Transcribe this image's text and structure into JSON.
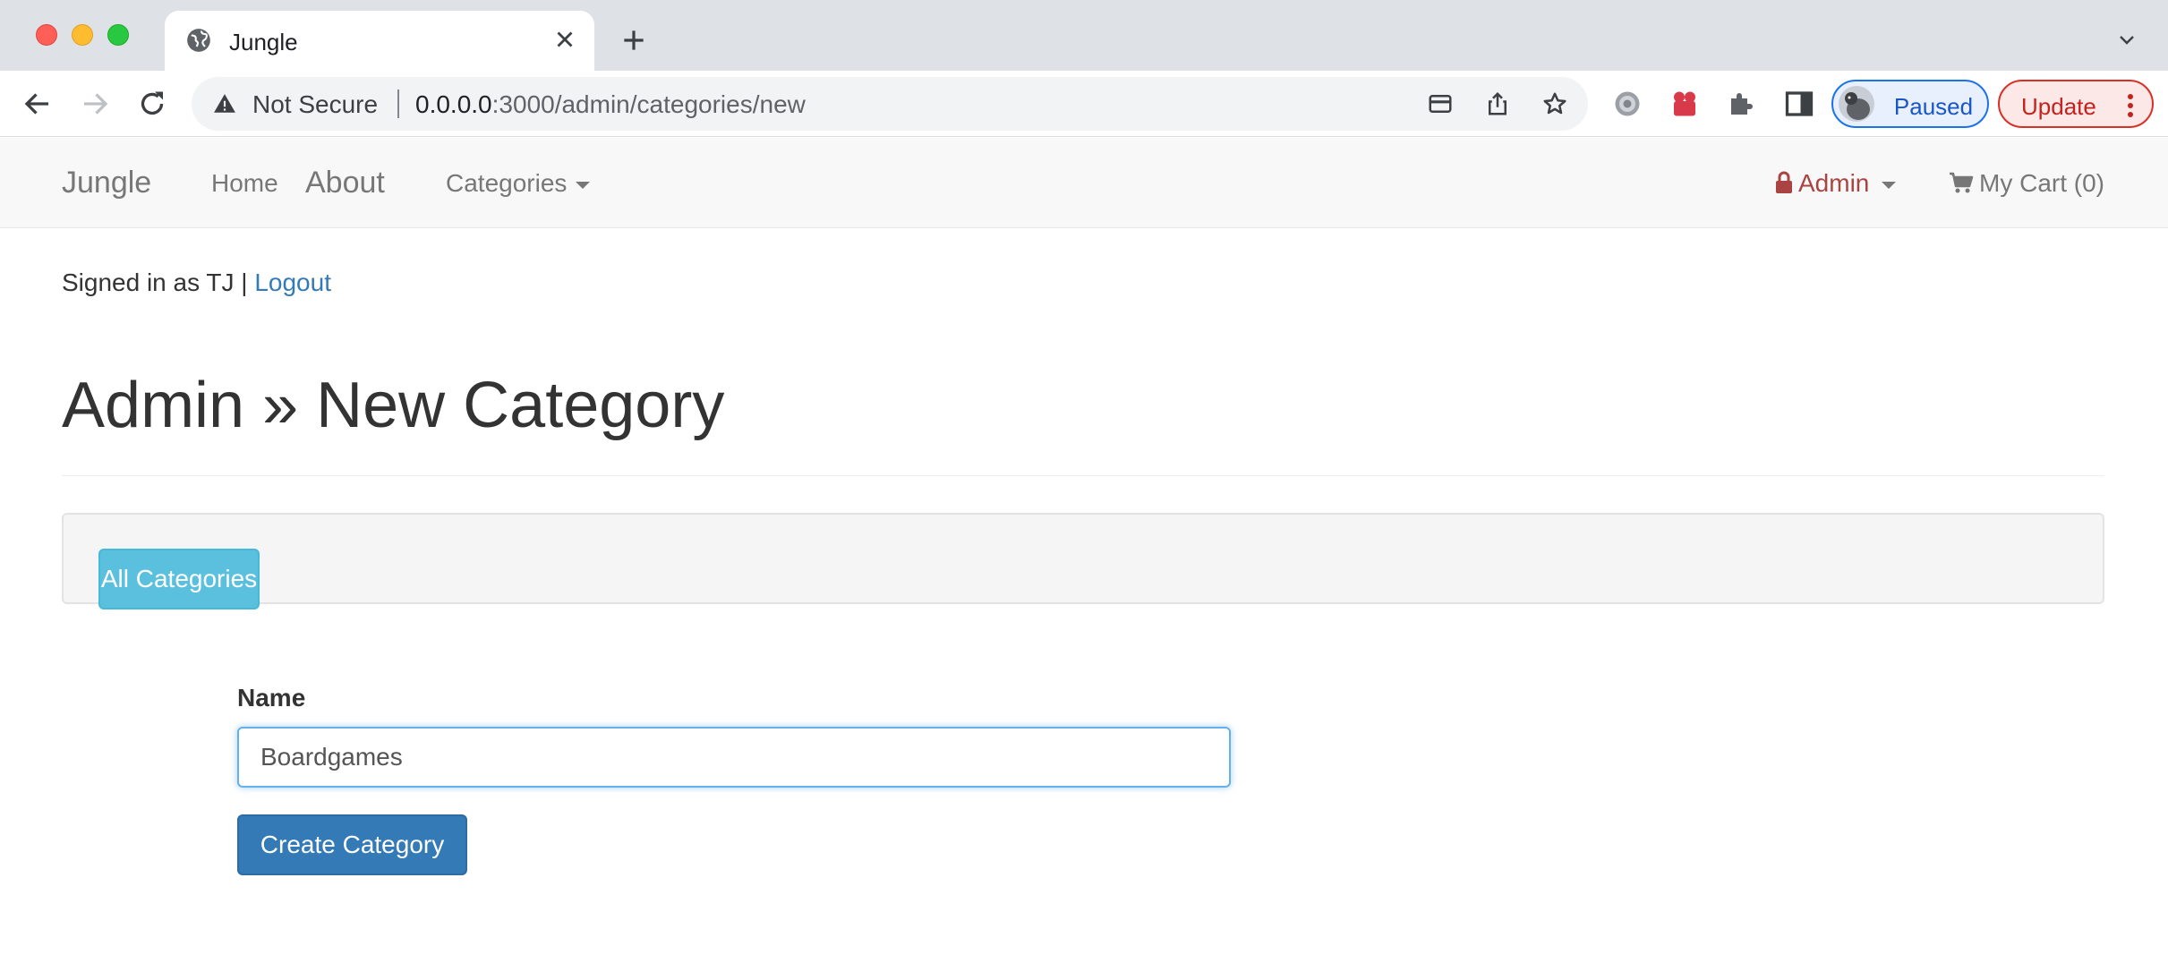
{
  "browser": {
    "tab": {
      "title": "Jungle"
    },
    "address_bar": {
      "security_label": "Not Secure",
      "url_host": "0.0.0.0",
      "url_path": ":3000/admin/categories/new"
    },
    "profile": {
      "label": "Paused"
    },
    "update": {
      "label": "Update"
    }
  },
  "navbar": {
    "brand": "Jungle",
    "home": "Home",
    "about": "About",
    "categories": "Categories",
    "admin": "Admin",
    "cart": "My Cart (0)"
  },
  "session": {
    "signed_in_text": "Signed in as TJ | ",
    "logout": "Logout"
  },
  "page": {
    "title": "Admin » New Category",
    "all_categories_button": "All Categories"
  },
  "form": {
    "name_label": "Name",
    "name_value": "Boardgames",
    "submit": "Create Category"
  },
  "colors": {
    "admin_accent": "#a94442",
    "info_button": "#5bc0de",
    "primary_button": "#337ab7",
    "link": "#337ab7"
  }
}
